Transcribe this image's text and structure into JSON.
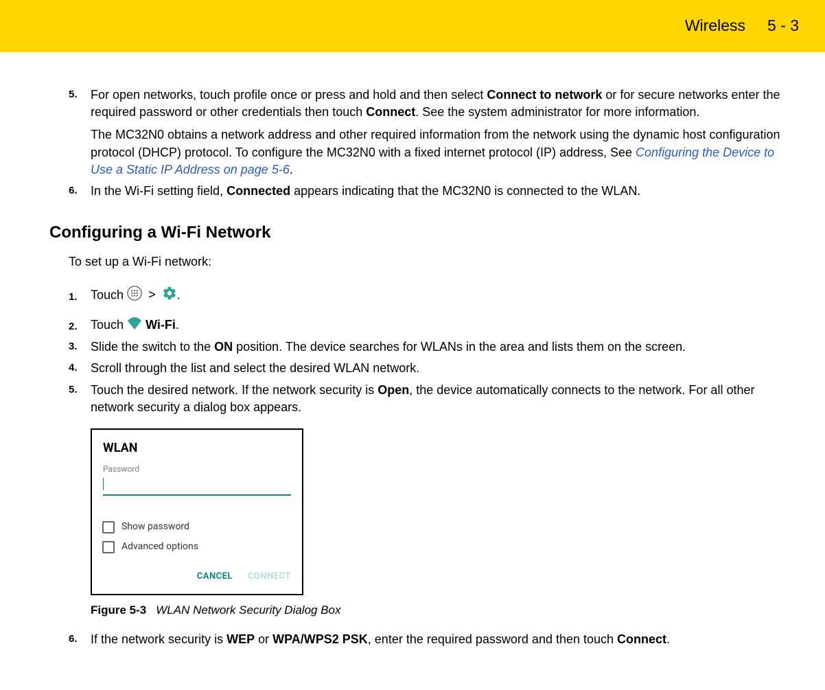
{
  "header": {
    "chapter": "Wireless",
    "page": "5 - 3"
  },
  "step5": {
    "num": "5.",
    "text_a": "For open networks, touch profile once or press and hold and then select ",
    "bold_a": "Connect to network",
    "text_b": " or for secure networks enter the required password or other credentials then touch ",
    "bold_b": "Connect",
    "text_c": ". See the system administrator for more information.",
    "para2_a": "The MC32N0 obtains a network address and other required information from the network using the dynamic host configuration protocol (DHCP) protocol. To configure the MC32N0 with a fixed internet protocol (IP) address, See ",
    "link": "Configuring the Device to Use a Static IP Address on page 5-6",
    "para2_b": "."
  },
  "step6a": {
    "num": "6.",
    "text_a": "In the Wi-Fi setting field, ",
    "bold_a": "Connected",
    "text_b": " appears indicating that the MC32N0 is connected to the WLAN."
  },
  "section_title": "Configuring a Wi-Fi Network",
  "intro": "To set up a Wi-Fi network:",
  "cfg": {
    "s1_num": "1.",
    "s1_text": "Touch ",
    "s1_tail": ".",
    "s2_num": "2.",
    "s2_text": "Touch ",
    "s2_bold": "Wi-Fi",
    "s2_tail": ".",
    "s3_num": "3.",
    "s3_a": "Slide the switch to the ",
    "s3_bold": "ON",
    "s3_b": " position. The device searches for WLANs in the area and lists them on the screen.",
    "s4_num": "4.",
    "s4_text": "Scroll through the list and select the desired WLAN network.",
    "s5_num": "5.",
    "s5_a": "Touch the desired network. If the network security is ",
    "s5_bold": "Open",
    "s5_b": ", the device automatically connects to the network. For all other network security a dialog box appears.",
    "s6_num": "6.",
    "s6_a": "If the network security is ",
    "s6_bold1": "WEP",
    "s6_mid": " or ",
    "s6_bold2": "WPA/WPS2 PSK",
    "s6_b": ", enter the required password and then touch ",
    "s6_bold3": "Connect",
    "s6_tail": "."
  },
  "dialog": {
    "title": "WLAN",
    "password_label": "Password",
    "show_password": "Show password",
    "advanced": "Advanced options",
    "cancel": "CANCEL",
    "connect": "CONNECT"
  },
  "figure": {
    "num": "Figure 5-3",
    "title": "WLAN Network Security Dialog Box"
  }
}
